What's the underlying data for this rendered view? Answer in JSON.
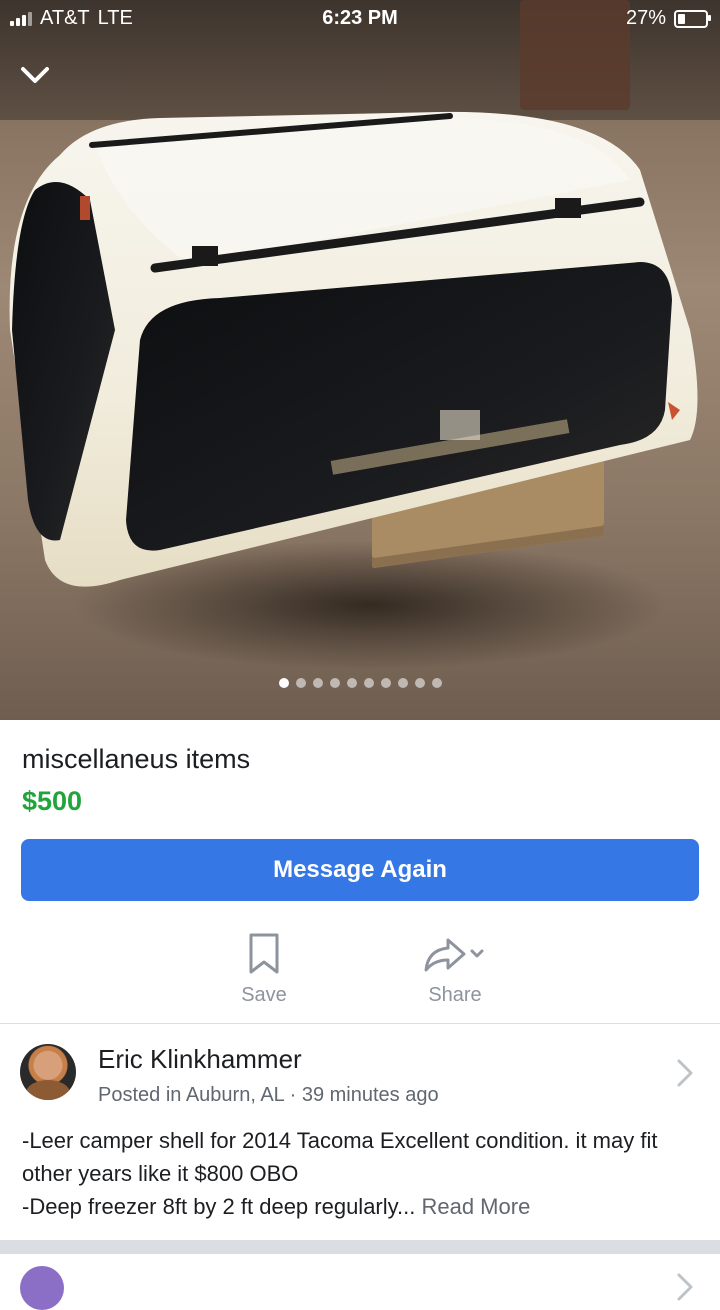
{
  "status_bar": {
    "carrier": "AT&T",
    "network": "LTE",
    "time": "6:23 PM",
    "battery_percent": "27%",
    "battery_level": 0.27
  },
  "gallery": {
    "image_count": 10,
    "active_index": 0
  },
  "listing": {
    "title": "miscellaneus items",
    "price": "$500",
    "message_button": "Message Again"
  },
  "actions": {
    "save_label": "Save",
    "share_label": "Share"
  },
  "seller": {
    "name": "Eric Klinkhammer",
    "meta": "Posted in Auburn, AL · 39 minutes ago"
  },
  "description": {
    "line1": "-Leer camper shell for 2014 Tacoma Excellent condition. it may fit other years like it $800 OBO",
    "line2": "-Deep freezer 8ft by 2 ft deep regularly... ",
    "read_more": "Read More"
  },
  "colors": {
    "price_green": "#21a43b",
    "button_blue": "#3578e5",
    "secondary_gray": "#606770"
  },
  "icons": [
    "chevron-down-icon",
    "bookmark-icon",
    "share-arrow-icon",
    "chevron-right-icon"
  ]
}
